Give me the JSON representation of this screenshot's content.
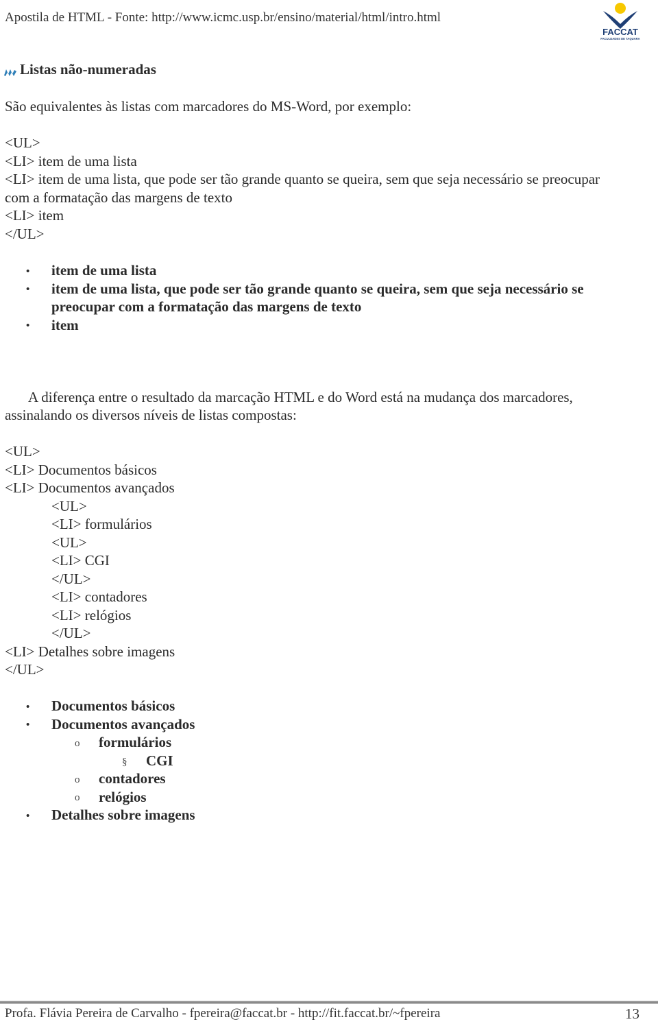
{
  "header": {
    "title": "Apostila de HTML - Fonte: http://www.icmc.usp.br/ensino/material/html/intro.html",
    "logo_text": "FACCAT",
    "logo_subtext": "FACULDADES DE TAQUARA",
    "colors": {
      "logo_navy": "#1f3f75",
      "logo_yellow": "#f7c800"
    }
  },
  "section": {
    "heading": "Listas não-numeradas",
    "intro": "São equivalentes às listas com marcadores do MS-Word, por exemplo:"
  },
  "code_example_1": [
    "<UL>",
    "<LI> item de uma lista",
    "<LI> item de uma lista, que pode ser tão grande quanto se queira, sem que seja necessário se preocupar",
    "com a formatação das margens de texto",
    "<LI> item",
    "</UL>"
  ],
  "rendered_list_1": {
    "bullet": "•",
    "items": [
      {
        "lines": [
          "item de uma lista"
        ]
      },
      {
        "lines": [
          "item de uma lista, que pode ser tão grande quanto se queira, sem que seja necessário se",
          "preocupar com a formatação das margens de texto"
        ]
      },
      {
        "lines": [
          "item"
        ]
      }
    ]
  },
  "paragraph": {
    "lines": [
      "A diferença entre o resultado da marcação HTML e do Word está na mudança dos marcadores,",
      "assinalando os diversos níveis de listas compostas:"
    ]
  },
  "code_example_2": [
    {
      "indent": 0,
      "text": "<UL>"
    },
    {
      "indent": 0,
      "text": "<LI> Documentos básicos"
    },
    {
      "indent": 0,
      "text": "<LI> Documentos avançados"
    },
    {
      "indent": 1,
      "text": "<UL>"
    },
    {
      "indent": 1,
      "text": "<LI> formulários"
    },
    {
      "indent": 1,
      "text": "<UL>"
    },
    {
      "indent": 1,
      "text": "<LI> CGI"
    },
    {
      "indent": 1,
      "text": "</UL>"
    },
    {
      "indent": 1,
      "text": "<LI> contadores"
    },
    {
      "indent": 1,
      "text": "<LI> relógios"
    },
    {
      "indent": 1,
      "text": "</UL>"
    },
    {
      "indent": 0,
      "text": "<LI> Detalhes sobre imagens"
    },
    {
      "indent": 0,
      "text": "</UL>"
    }
  ],
  "rendered_list_2": [
    {
      "level": 0,
      "bullet": "•",
      "text": "Documentos básicos"
    },
    {
      "level": 0,
      "bullet": "•",
      "text": "Documentos avançados"
    },
    {
      "level": 1,
      "bullet": "o",
      "text": "formulários"
    },
    {
      "level": 2,
      "bullet": "§",
      "text": "CGI"
    },
    {
      "level": 1,
      "bullet": "o",
      "text": "contadores"
    },
    {
      "level": 1,
      "bullet": "o",
      "text": "relógios"
    },
    {
      "level": 0,
      "bullet": "•",
      "text": "Detalhes sobre imagens"
    }
  ],
  "footer": {
    "text": "Profa. Flávia Pereira de Carvalho - fpereira@faccat.br - http://fit.faccat.br/~fpereira",
    "page_number": "13"
  }
}
